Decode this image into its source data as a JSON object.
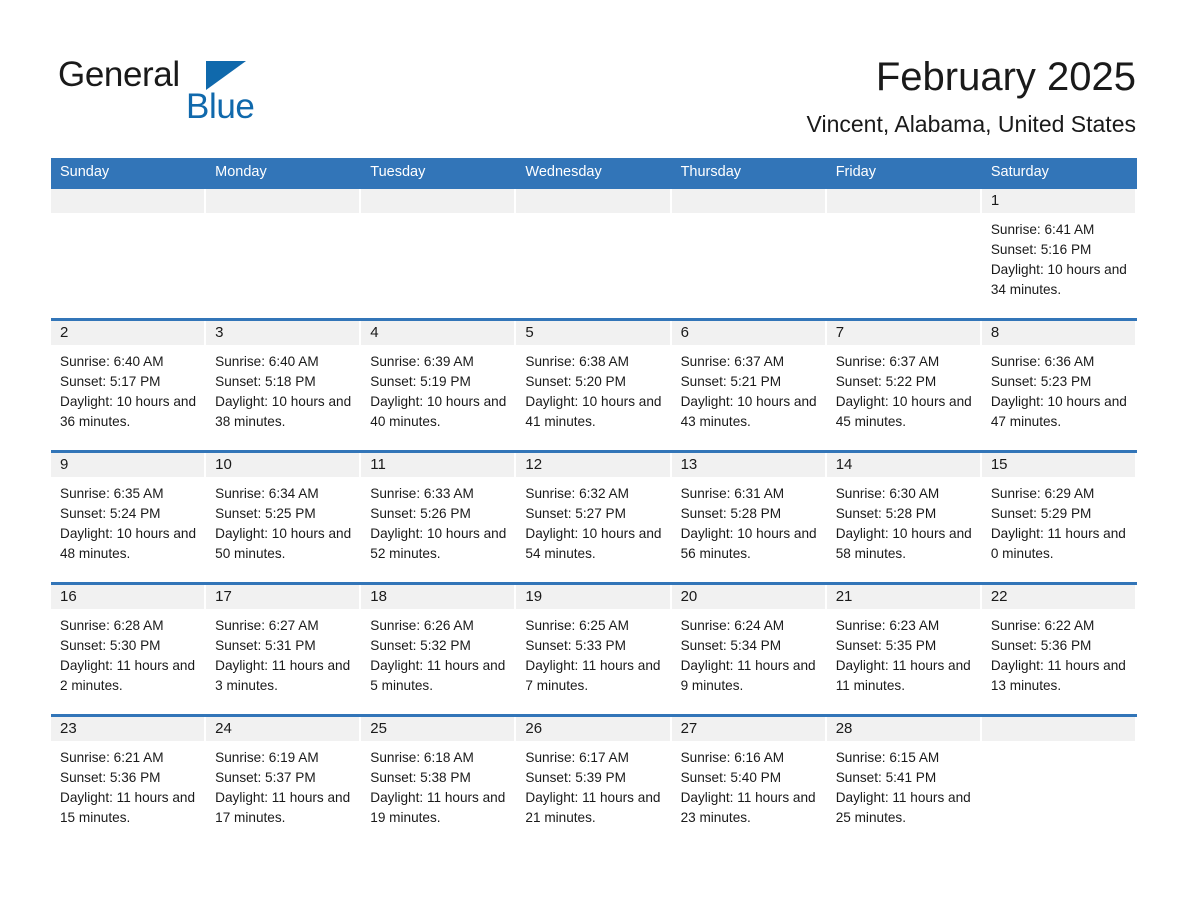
{
  "brand": {
    "name_part1": "General",
    "name_part2": "Blue",
    "triangle_color": "#1069ac",
    "accent_color": "#1069ac"
  },
  "header": {
    "month_title": "February 2025",
    "location": "Vincent, Alabama, United States",
    "header_bg": "#3275b8",
    "day_band_bg": "#f1f1f1"
  },
  "weekdays": [
    "Sunday",
    "Monday",
    "Tuesday",
    "Wednesday",
    "Thursday",
    "Friday",
    "Saturday"
  ],
  "weeks": [
    [
      {
        "day": "",
        "sunrise": "",
        "sunset": "",
        "daylight": ""
      },
      {
        "day": "",
        "sunrise": "",
        "sunset": "",
        "daylight": ""
      },
      {
        "day": "",
        "sunrise": "",
        "sunset": "",
        "daylight": ""
      },
      {
        "day": "",
        "sunrise": "",
        "sunset": "",
        "daylight": ""
      },
      {
        "day": "",
        "sunrise": "",
        "sunset": "",
        "daylight": ""
      },
      {
        "day": "",
        "sunrise": "",
        "sunset": "",
        "daylight": ""
      },
      {
        "day": "1",
        "sunrise": "Sunrise: 6:41 AM",
        "sunset": "Sunset: 5:16 PM",
        "daylight": "Daylight: 10 hours and 34 minutes."
      }
    ],
    [
      {
        "day": "2",
        "sunrise": "Sunrise: 6:40 AM",
        "sunset": "Sunset: 5:17 PM",
        "daylight": "Daylight: 10 hours and 36 minutes."
      },
      {
        "day": "3",
        "sunrise": "Sunrise: 6:40 AM",
        "sunset": "Sunset: 5:18 PM",
        "daylight": "Daylight: 10 hours and 38 minutes."
      },
      {
        "day": "4",
        "sunrise": "Sunrise: 6:39 AM",
        "sunset": "Sunset: 5:19 PM",
        "daylight": "Daylight: 10 hours and 40 minutes."
      },
      {
        "day": "5",
        "sunrise": "Sunrise: 6:38 AM",
        "sunset": "Sunset: 5:20 PM",
        "daylight": "Daylight: 10 hours and 41 minutes."
      },
      {
        "day": "6",
        "sunrise": "Sunrise: 6:37 AM",
        "sunset": "Sunset: 5:21 PM",
        "daylight": "Daylight: 10 hours and 43 minutes."
      },
      {
        "day": "7",
        "sunrise": "Sunrise: 6:37 AM",
        "sunset": "Sunset: 5:22 PM",
        "daylight": "Daylight: 10 hours and 45 minutes."
      },
      {
        "day": "8",
        "sunrise": "Sunrise: 6:36 AM",
        "sunset": "Sunset: 5:23 PM",
        "daylight": "Daylight: 10 hours and 47 minutes."
      }
    ],
    [
      {
        "day": "9",
        "sunrise": "Sunrise: 6:35 AM",
        "sunset": "Sunset: 5:24 PM",
        "daylight": "Daylight: 10 hours and 48 minutes."
      },
      {
        "day": "10",
        "sunrise": "Sunrise: 6:34 AM",
        "sunset": "Sunset: 5:25 PM",
        "daylight": "Daylight: 10 hours and 50 minutes."
      },
      {
        "day": "11",
        "sunrise": "Sunrise: 6:33 AM",
        "sunset": "Sunset: 5:26 PM",
        "daylight": "Daylight: 10 hours and 52 minutes."
      },
      {
        "day": "12",
        "sunrise": "Sunrise: 6:32 AM",
        "sunset": "Sunset: 5:27 PM",
        "daylight": "Daylight: 10 hours and 54 minutes."
      },
      {
        "day": "13",
        "sunrise": "Sunrise: 6:31 AM",
        "sunset": "Sunset: 5:28 PM",
        "daylight": "Daylight: 10 hours and 56 minutes."
      },
      {
        "day": "14",
        "sunrise": "Sunrise: 6:30 AM",
        "sunset": "Sunset: 5:28 PM",
        "daylight": "Daylight: 10 hours and 58 minutes."
      },
      {
        "day": "15",
        "sunrise": "Sunrise: 6:29 AM",
        "sunset": "Sunset: 5:29 PM",
        "daylight": "Daylight: 11 hours and 0 minutes."
      }
    ],
    [
      {
        "day": "16",
        "sunrise": "Sunrise: 6:28 AM",
        "sunset": "Sunset: 5:30 PM",
        "daylight": "Daylight: 11 hours and 2 minutes."
      },
      {
        "day": "17",
        "sunrise": "Sunrise: 6:27 AM",
        "sunset": "Sunset: 5:31 PM",
        "daylight": "Daylight: 11 hours and 3 minutes."
      },
      {
        "day": "18",
        "sunrise": "Sunrise: 6:26 AM",
        "sunset": "Sunset: 5:32 PM",
        "daylight": "Daylight: 11 hours and 5 minutes."
      },
      {
        "day": "19",
        "sunrise": "Sunrise: 6:25 AM",
        "sunset": "Sunset: 5:33 PM",
        "daylight": "Daylight: 11 hours and 7 minutes."
      },
      {
        "day": "20",
        "sunrise": "Sunrise: 6:24 AM",
        "sunset": "Sunset: 5:34 PM",
        "daylight": "Daylight: 11 hours and 9 minutes."
      },
      {
        "day": "21",
        "sunrise": "Sunrise: 6:23 AM",
        "sunset": "Sunset: 5:35 PM",
        "daylight": "Daylight: 11 hours and 11 minutes."
      },
      {
        "day": "22",
        "sunrise": "Sunrise: 6:22 AM",
        "sunset": "Sunset: 5:36 PM",
        "daylight": "Daylight: 11 hours and 13 minutes."
      }
    ],
    [
      {
        "day": "23",
        "sunrise": "Sunrise: 6:21 AM",
        "sunset": "Sunset: 5:36 PM",
        "daylight": "Daylight: 11 hours and 15 minutes."
      },
      {
        "day": "24",
        "sunrise": "Sunrise: 6:19 AM",
        "sunset": "Sunset: 5:37 PM",
        "daylight": "Daylight: 11 hours and 17 minutes."
      },
      {
        "day": "25",
        "sunrise": "Sunrise: 6:18 AM",
        "sunset": "Sunset: 5:38 PM",
        "daylight": "Daylight: 11 hours and 19 minutes."
      },
      {
        "day": "26",
        "sunrise": "Sunrise: 6:17 AM",
        "sunset": "Sunset: 5:39 PM",
        "daylight": "Daylight: 11 hours and 21 minutes."
      },
      {
        "day": "27",
        "sunrise": "Sunrise: 6:16 AM",
        "sunset": "Sunset: 5:40 PM",
        "daylight": "Daylight: 11 hours and 23 minutes."
      },
      {
        "day": "28",
        "sunrise": "Sunrise: 6:15 AM",
        "sunset": "Sunset: 5:41 PM",
        "daylight": "Daylight: 11 hours and 25 minutes."
      },
      {
        "day": "",
        "sunrise": "",
        "sunset": "",
        "daylight": ""
      }
    ]
  ]
}
